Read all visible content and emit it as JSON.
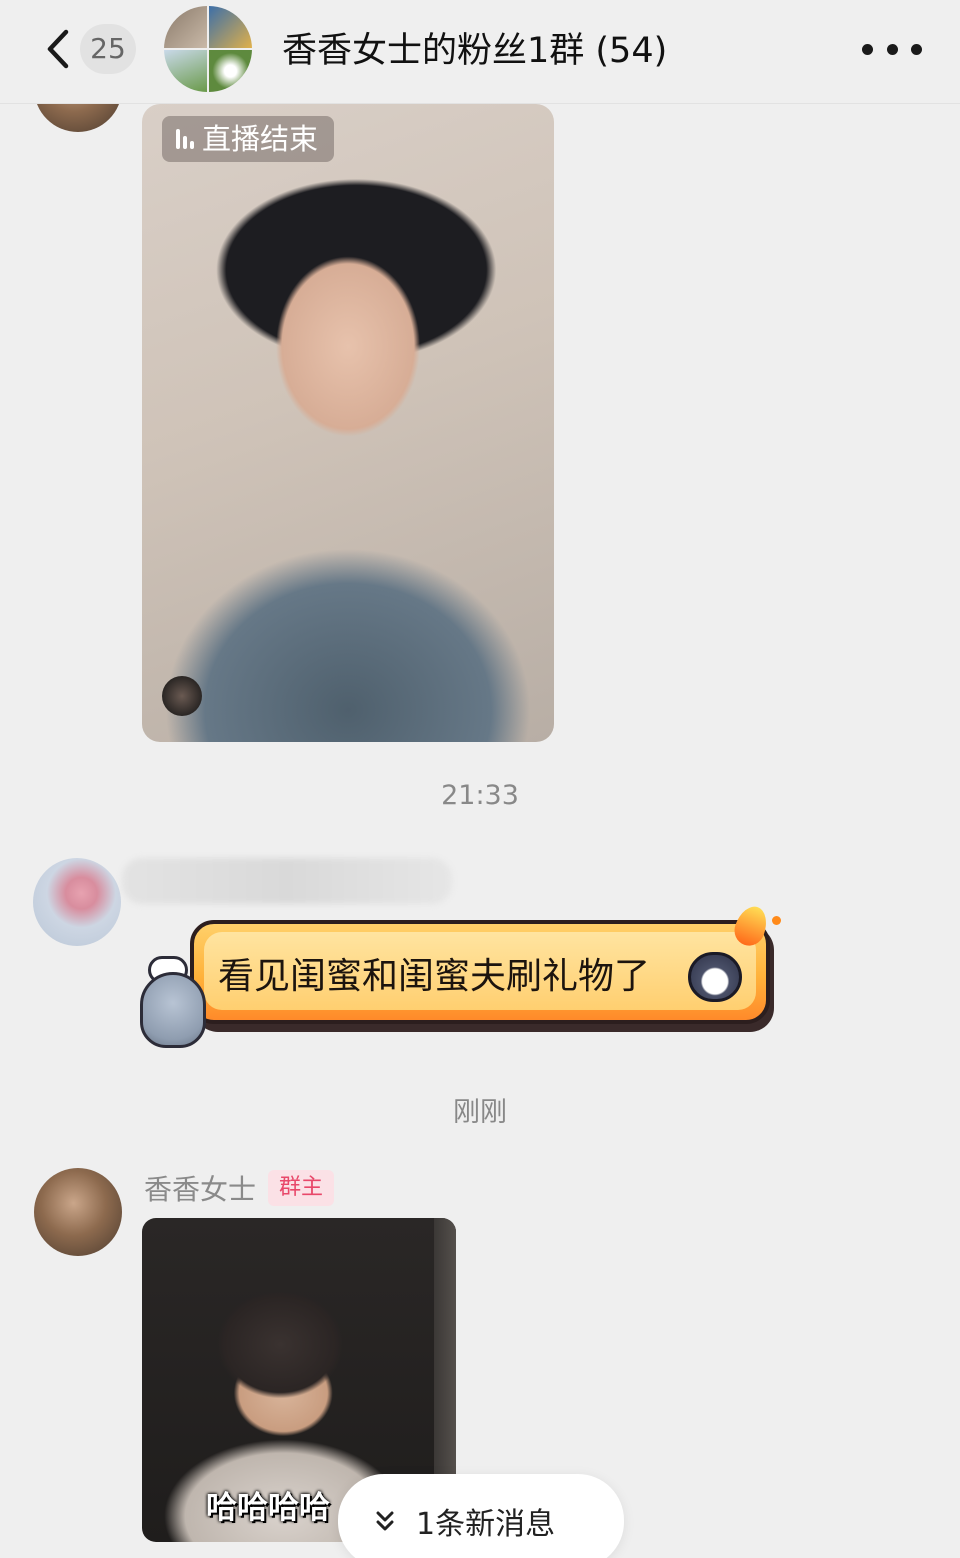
{
  "header": {
    "unread_count": "25",
    "title": "香香女士的粉丝1群 (54)"
  },
  "live_card": {
    "badge": "直播结束"
  },
  "timestamps": {
    "first": "21:33",
    "second": "刚刚"
  },
  "fan_message": {
    "text": "看见闺蜜和闺蜜夫刷礼物了"
  },
  "host": {
    "name": "香香女士",
    "badge": "群主"
  },
  "video": {
    "subtitle": "哈哈哈哈"
  },
  "new_message_pill": {
    "label": "1条新消息"
  },
  "colors": {
    "background": "#efefef",
    "owner_badge_bg": "#fbe1e6",
    "owner_badge_text": "#e8486a",
    "bubble_orange": "#ffb23a"
  },
  "icons": [
    "back-arrow-icon",
    "more-icon",
    "live-bars-icon",
    "chevron-double-down-icon"
  ]
}
